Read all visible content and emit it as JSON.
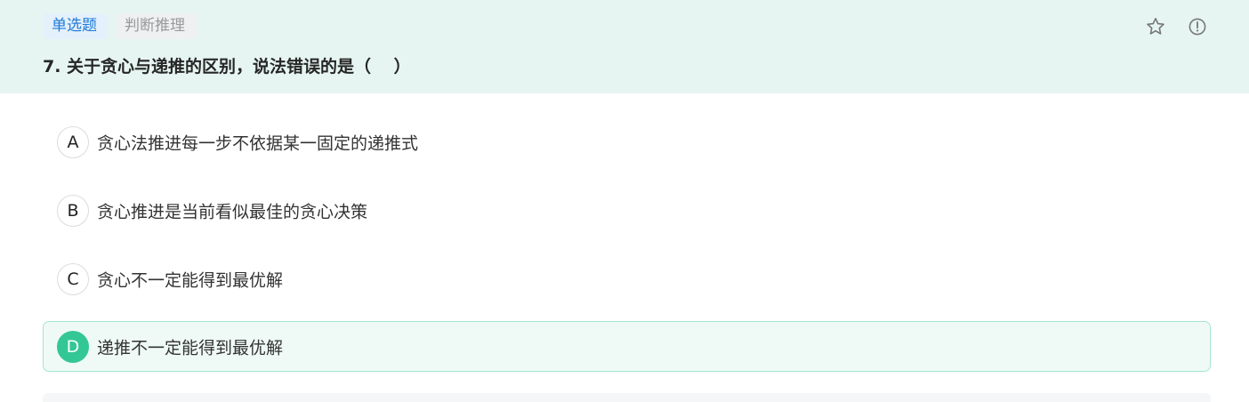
{
  "header": {
    "type_tag": "单选题",
    "category_tag": "判断推理",
    "favorite_icon": "star-icon",
    "report_icon": "info-icon",
    "background_color": "#e6f5f1"
  },
  "question": {
    "title": "7. 关于贪心与递推的区别，说法错误的是（　 ）"
  },
  "options": [
    {
      "letter": "A",
      "text": "贪心法推进每一步不依据某一固定的递推式",
      "selected": false
    },
    {
      "letter": "B",
      "text": "贪心推进是当前看似最佳的贪心决策",
      "selected": false
    },
    {
      "letter": "C",
      "text": "贪心不一定能得到最优解",
      "selected": false
    },
    {
      "letter": "D",
      "text": "递推不一定能得到最优解",
      "selected": true
    }
  ],
  "colors": {
    "accent_green": "#34c796",
    "tag_blue": "#1f7ad6"
  }
}
